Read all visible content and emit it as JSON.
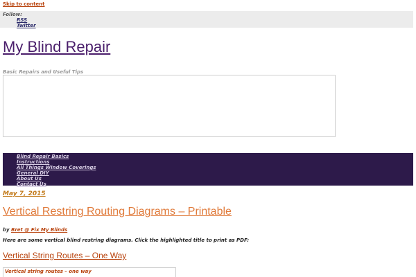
{
  "skip_link": "Skip to content",
  "follow": {
    "label": "Follow:",
    "items": [
      "RSS",
      "Twitter"
    ]
  },
  "site": {
    "title": "My Blind Repair",
    "description": "Basic Repairs and Useful Tips"
  },
  "nav": {
    "items": [
      "Blind Repair Basics",
      "Instructions",
      "All Things Window Coverings",
      "General DIY",
      "About Us",
      "Contact Us"
    ]
  },
  "post": {
    "date": "May 7, 2015",
    "title": "Vertical Restring Routing Diagrams – Printable",
    "byline_prefix": "by",
    "author": "Bret @ Fix My Blinds",
    "intro": "Here are some vertical blind restring diagrams. Click the highlighted title to print as PDF:",
    "section_title": "Vertical String Routes – One Way",
    "figure_caption": "Vertical string routes – one way"
  },
  "colors": {
    "nav_background": "#2d1a4a",
    "follow_background": "#ececec",
    "link_accent": "#b8420c",
    "title_purple": "#4a1e6b",
    "post_title_orange": "#e07a3a"
  }
}
